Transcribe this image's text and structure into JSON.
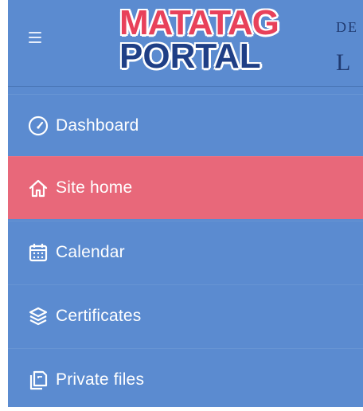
{
  "header": {
    "menu_icon": "hamburger-menu-icon",
    "logo_line1": "MATATAG",
    "logo_line2": "PORTAL",
    "dep_text": "DE",
    "l_text": "L"
  },
  "nav": [
    {
      "label": "Dashboard",
      "icon": "speedometer-icon",
      "active": false
    },
    {
      "label": "Site home",
      "icon": "home-icon",
      "active": true
    },
    {
      "label": "Calendar",
      "icon": "calendar-icon",
      "active": false
    },
    {
      "label": "Certificates",
      "icon": "stack-icon",
      "active": false
    },
    {
      "label": "Private files",
      "icon": "files-icon",
      "active": false
    }
  ],
  "colors": {
    "sidebar_bg": "#5b8bd0",
    "active_bg": "#e8687a",
    "logo_red": "#e8415a",
    "logo_blue": "#1f3f86"
  }
}
